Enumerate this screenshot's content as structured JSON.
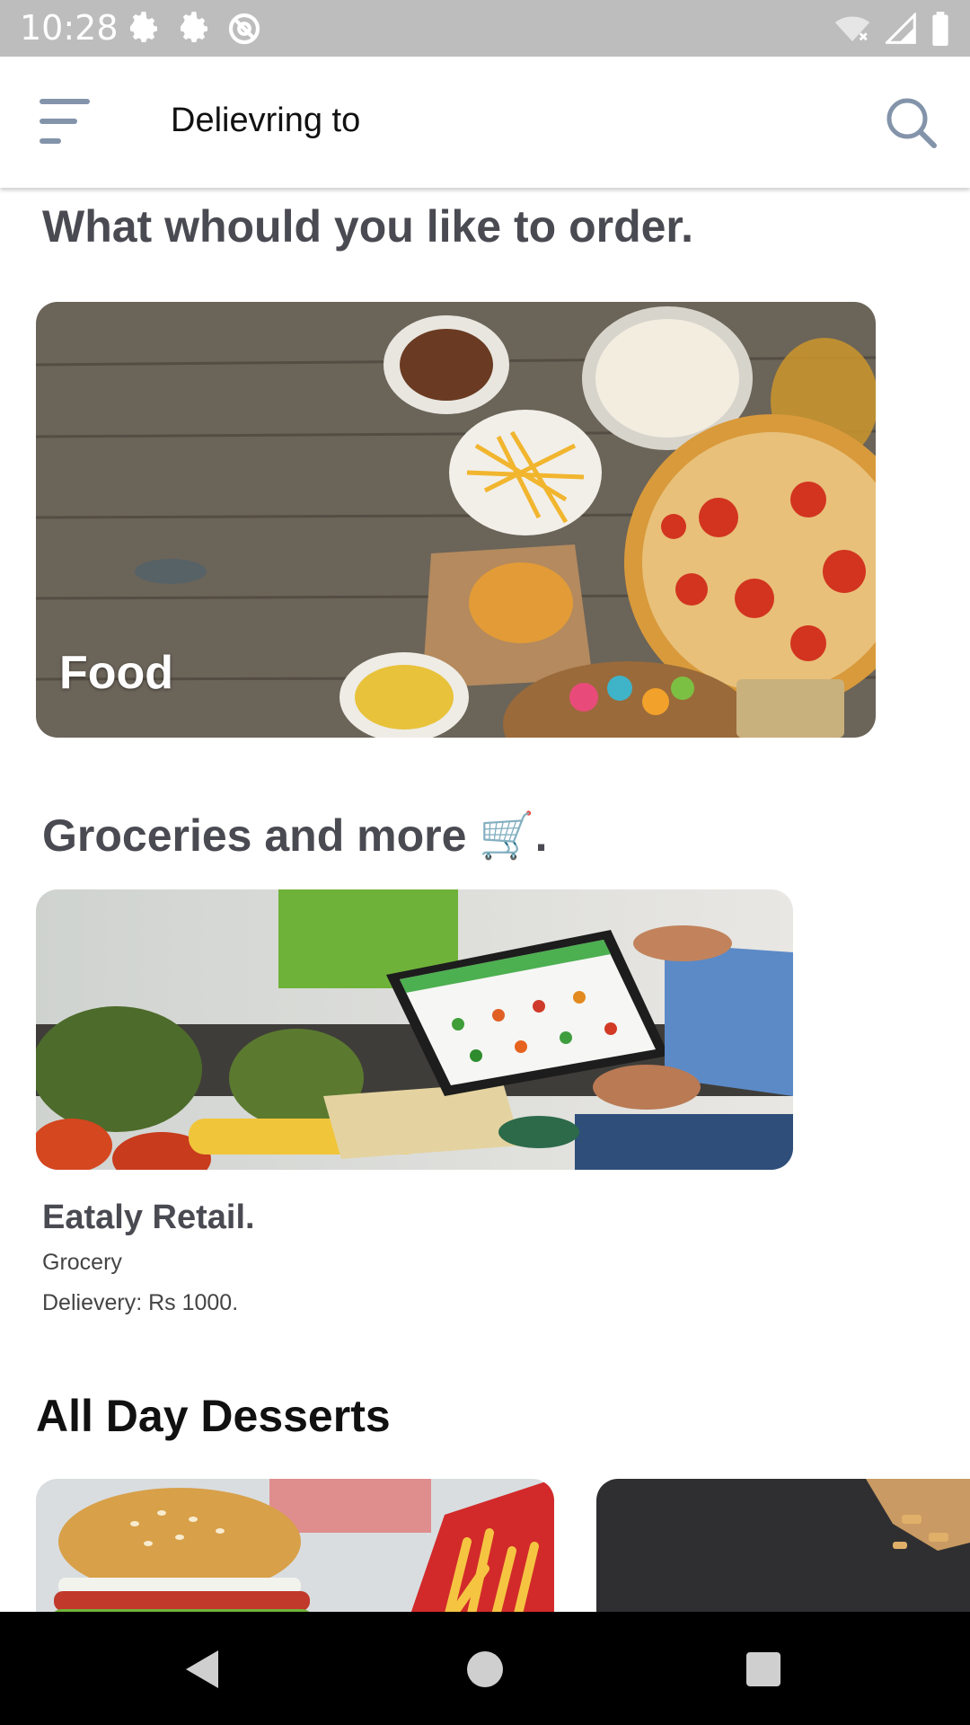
{
  "status_bar": {
    "time": "10:28",
    "left_icons": [
      "gear-icon",
      "gear-icon",
      "at-sign-icon"
    ],
    "right_icons": [
      "wifi-off-icon",
      "signal-icon",
      "battery-icon"
    ]
  },
  "app_bar": {
    "title": "Delievring to",
    "menu_icon": "menu-icon",
    "search_icon": "search-icon"
  },
  "sections": {
    "order_heading": "What whould you like to order.",
    "food_card_label": "Food",
    "groceries_heading": "Groceries and more",
    "groceries_emoji": "🛒",
    "groceries_suffix": ".",
    "store": {
      "name": "Eataly Retail.",
      "category": "Grocery",
      "delivery": "Delievery: Rs 1000."
    },
    "desserts_heading": "All Day Desserts"
  },
  "colors": {
    "status_bar": "#bdbdbd",
    "heading_text": "#4a4a52",
    "nav_bar": "#000000"
  },
  "nav_bar": {
    "buttons": [
      "back-icon",
      "home-icon",
      "recents-icon"
    ]
  }
}
